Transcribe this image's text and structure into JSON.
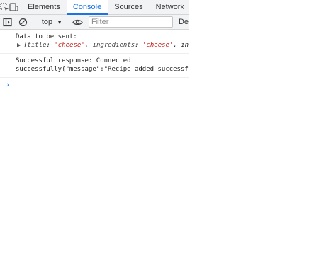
{
  "tabs": [
    {
      "label": "Elements"
    },
    {
      "label": "Console"
    },
    {
      "label": "Sources"
    },
    {
      "label": "Network"
    }
  ],
  "active_tab": "Console",
  "toolbar": {
    "context_label": "top",
    "filter_placeholder": "Filter",
    "levels_label": "De"
  },
  "console": {
    "messages": [
      {
        "text": "Data to be sent:",
        "object": {
          "open": "{",
          "key1": "title",
          "sep": ": ",
          "val1": "'cheese'",
          "comma": ", ",
          "key2": "ingredients",
          "val2": "'cheese'",
          "tail": ", in"
        }
      },
      {
        "line1": "Successful response: Connected",
        "line2": "successfully{\"message\":\"Recipe added successfu"
      }
    ],
    "prompt": "›"
  },
  "colors": {
    "accent": "#1a73e8",
    "string": "#c41a16",
    "toolbar_bg": "#f1f3f4"
  },
  "icons": [
    "inspect-element-icon",
    "device-toolbar-icon",
    "sidebar-toggle-icon",
    "clear-console-icon",
    "eye-icon",
    "dropdown-caret-icon",
    "expand-triangle-icon",
    "console-prompt-icon"
  ]
}
